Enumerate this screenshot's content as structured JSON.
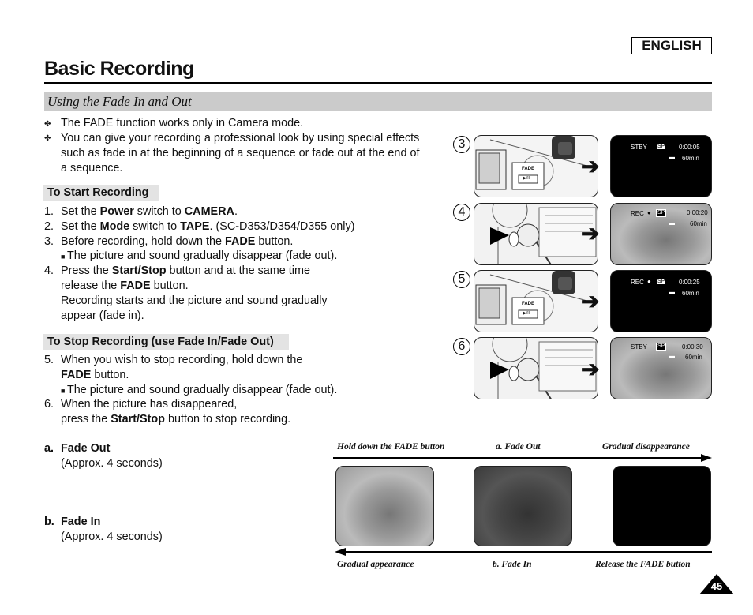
{
  "header": {
    "language": "ENGLISH",
    "title": "Basic Recording",
    "section": "Using the Fade In and Out"
  },
  "intro_bullets": [
    {
      "icon": "four-point-star-bullet-icon",
      "lines": [
        "The FADE function works only in Camera mode."
      ]
    },
    {
      "icon": "four-point-star-bullet-icon",
      "lines": [
        "You can give your recording a professional look by using special effects",
        "such as fade in at the beginning of a sequence or fade out at the end of",
        "a sequence."
      ]
    }
  ],
  "start_section": {
    "heading": "To Start Recording",
    "steps": [
      {
        "num": "1.",
        "parts": [
          "Set the ",
          "Power",
          " switch to ",
          "CAMERA",
          "."
        ]
      },
      {
        "num": "2.",
        "parts": [
          "Set the ",
          "Mode",
          " switch to ",
          "TAPE",
          ". (SC-D353/D354/D355 only)"
        ]
      },
      {
        "num": "3.",
        "parts": [
          "Before recording, hold down the ",
          "FADE",
          " button."
        ]
      },
      {
        "note": "The picture and sound gradually disappear (fade out)."
      },
      {
        "num": "4.",
        "parts": [
          "Press the ",
          "Start/Stop",
          " button and at the same time"
        ]
      },
      {
        "parts": [
          "release the ",
          "FADE",
          " button."
        ]
      },
      {
        "text": "Recording starts and the picture and sound gradually"
      },
      {
        "text": "appear (fade in)."
      }
    ]
  },
  "stop_section": {
    "heading": "To Stop Recording (use Fade In/Fade Out)",
    "steps": [
      {
        "num": "5.",
        "text": "When you wish to stop recording, hold down the"
      },
      {
        "parts": [
          "FADE",
          " button."
        ]
      },
      {
        "note": "The picture and sound gradually disappear (fade out)."
      },
      {
        "num": "6.",
        "text": "When the picture has disappeared,"
      },
      {
        "parts": [
          "press the ",
          "Start/Stop",
          " button to stop recording."
        ]
      }
    ]
  },
  "fade_notes": [
    {
      "label": "a.",
      "title": "Fade Out",
      "detail": "(Approx. 4 seconds)"
    },
    {
      "label": "b.",
      "title": "Fade In",
      "detail": "(Approx. 4 seconds)"
    }
  ],
  "illustrations": [
    {
      "step": "3",
      "camera_label": "FADE",
      "camera_button": "▶/II",
      "screen": {
        "status": "STBY",
        "rec_dot": false,
        "mode": "SP",
        "time": "0:00:05",
        "tape": "60min",
        "image": "black"
      }
    },
    {
      "step": "4",
      "screen": {
        "status": "REC",
        "rec_dot": true,
        "mode": "SP",
        "time": "0:00:20",
        "tape": "60min",
        "image": "dolphin"
      }
    },
    {
      "step": "5",
      "camera_label": "FADE",
      "camera_button": "▶/II",
      "screen": {
        "status": "REC",
        "rec_dot": true,
        "mode": "SP",
        "time": "0:00:25",
        "tape": "60min",
        "image": "black"
      }
    },
    {
      "step": "6",
      "screen": {
        "status": "STBY",
        "rec_dot": false,
        "mode": "SP",
        "time": "0:00:30",
        "tape": "60min",
        "image": "dolphin"
      }
    }
  ],
  "timeline": {
    "top_captions": [
      "Hold down the FADE button",
      "a. Fade Out",
      "Gradual disappearance"
    ],
    "bottom_captions": [
      "Gradual appearance",
      "b. Fade In",
      "Release the FADE button"
    ],
    "frames": [
      "bright dolphin",
      "dim dolphin",
      "black"
    ]
  },
  "page_number": "45"
}
